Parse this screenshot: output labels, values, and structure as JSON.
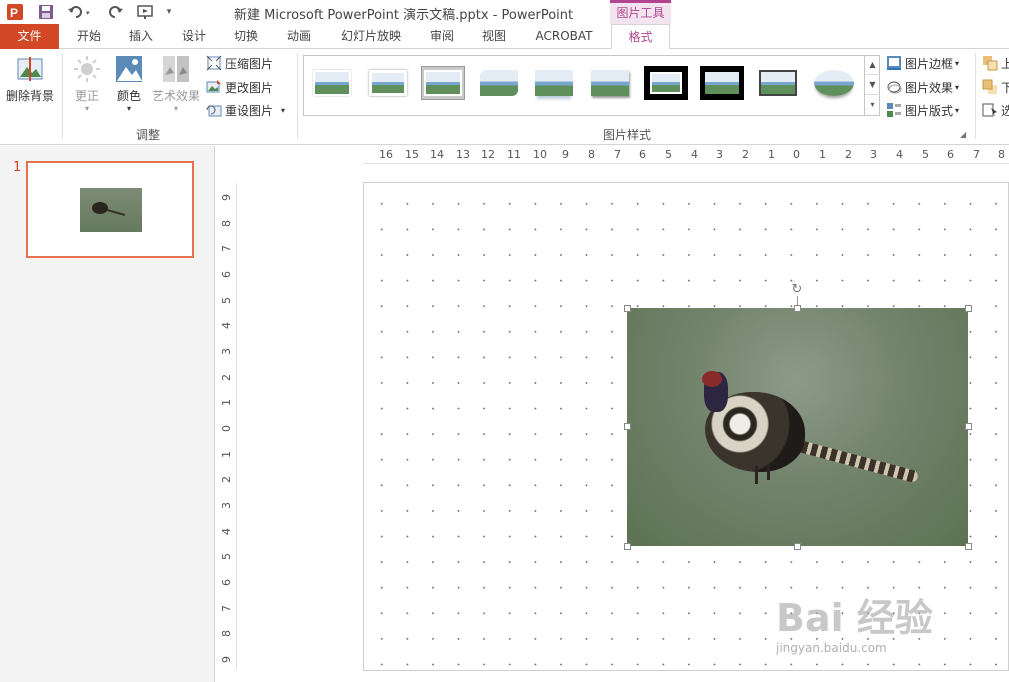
{
  "window": {
    "title": "新建 Microsoft PowerPoint 演示文稿.pptx - PowerPoint"
  },
  "quick_access": [
    "powerpoint-logo-icon",
    "save-icon",
    "undo-icon",
    "redo-icon",
    "start-from-beginning-icon",
    "customize-dropdown-icon"
  ],
  "context_tab_header": "图片工具",
  "tabs": [
    {
      "label": "文件",
      "active": false
    },
    {
      "label": "开始",
      "active": false
    },
    {
      "label": "插入",
      "active": false
    },
    {
      "label": "设计",
      "active": false
    },
    {
      "label": "切换",
      "active": false
    },
    {
      "label": "动画",
      "active": false
    },
    {
      "label": "幻灯片放映",
      "active": false
    },
    {
      "label": "审阅",
      "active": false
    },
    {
      "label": "视图",
      "active": false
    },
    {
      "label": "ACROBAT",
      "active": false
    },
    {
      "label": "格式",
      "active": true
    }
  ],
  "ribbon": {
    "remove_background": "删除背景",
    "corrections": "更正",
    "color": "颜色",
    "artistic_effects": "艺术效果",
    "compress_pictures": "压缩图片",
    "change_picture": "更改图片",
    "reset_picture": "重设图片",
    "adjust_group": "调整",
    "picture_styles_group": "图片样式",
    "picture_border": "图片边框",
    "picture_effects": "图片效果",
    "picture_layout": "图片版式",
    "arrange_bring_forward": "上",
    "arrange_send_backward": "下",
    "arrange_selection_pane": "选",
    "style_thumbnails": [
      "simple-frame-white",
      "soft-edge",
      "beveled-matte",
      "rounded-diagonal",
      "reflected-bevel",
      "drop-shadow",
      "thick-black-frame",
      "black-frame",
      "metal-frame",
      "oval-soft"
    ]
  },
  "slide_pane": {
    "slide_number": "1"
  },
  "ruler": {
    "horizontal": [
      "16",
      "15",
      "14",
      "13",
      "12",
      "11",
      "10",
      "9",
      "8",
      "7",
      "6",
      "5",
      "4",
      "3",
      "2",
      "1",
      "0",
      "1",
      "2",
      "3",
      "4",
      "5",
      "6",
      "7",
      "8"
    ],
    "vertical": [
      "9",
      "8",
      "7",
      "6",
      "5",
      "4",
      "3",
      "2",
      "1",
      "0",
      "1",
      "2",
      "3",
      "4",
      "5",
      "6",
      "7",
      "8",
      "9"
    ]
  },
  "watermark": {
    "text": "Bai 经验",
    "url": "jingyan.baidu.com"
  },
  "colors": {
    "file_tab": "#d24726",
    "context_accent": "#b24592",
    "slide_thumb_border": "#e6734d"
  }
}
